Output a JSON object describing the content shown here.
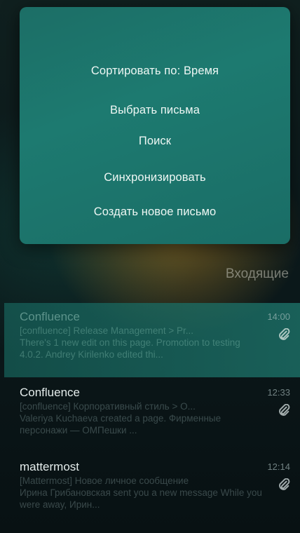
{
  "menu": {
    "items": [
      "Сортировать по: Время",
      "Выбрать письма",
      "Поиск",
      "Синхронизировать",
      "Создать новое письмо"
    ]
  },
  "folder": {
    "title": "Входящие"
  },
  "mails": [
    {
      "sender": "Confluence",
      "time": "14:00",
      "subject": "[confluence] Release Management > Pr...",
      "preview": "There's 1 new edit on this page. Promotion to testing 4.0.2. Andrey Kirilenko edited thi...",
      "has_attachment": true,
      "selected": true
    },
    {
      "sender": "Confluence",
      "time": "12:33",
      "subject": "[confluence] Корпоративный стиль > О...",
      "preview": "Valeriya Kuchaeva created a page. Фирменные персонажи — ОМПешки ...",
      "has_attachment": true,
      "selected": false
    },
    {
      "sender": "mattermost",
      "time": "12:14",
      "subject": "[Mattermost] Новое личное сообщение",
      "preview": "Ирина Грибановская sent you a new message While you were away, Ирин...",
      "has_attachment": true,
      "selected": false
    }
  ]
}
